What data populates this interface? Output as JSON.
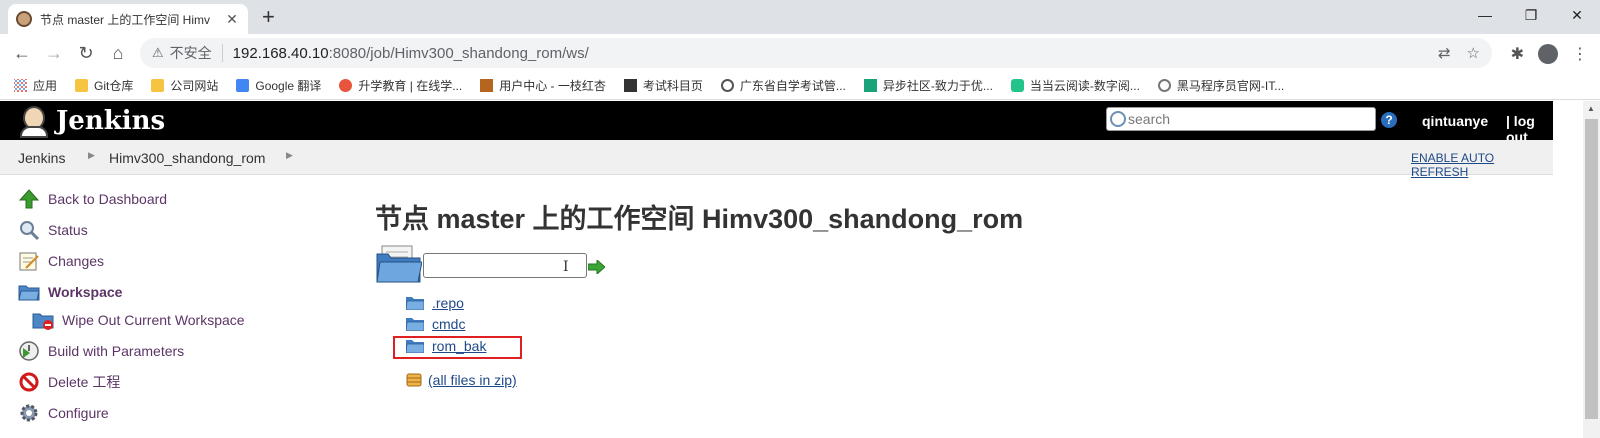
{
  "browser": {
    "tab_title": "节点 master 上的工作空间 Himv",
    "tab_close": "✕",
    "new_tab": "+",
    "window_controls": {
      "minimize": "—",
      "maximize": "❐",
      "close": "✕"
    },
    "nav": {
      "back": "←",
      "forward": "→",
      "reload": "↻",
      "home": "⌂"
    },
    "security_icon": "⚠",
    "security_label": "不安全",
    "url_host": "192.168.40.10",
    "url_path": ":8080/job/Himv300_shandong_rom/ws/",
    "omnibox_icons": {
      "translate": "⇄",
      "bookmark_star": "☆"
    },
    "toolbar_icons": {
      "extensions": "✱",
      "menu": "⋮"
    },
    "bookmarks": [
      {
        "label": "应用",
        "icon": "apps-grid-icon"
      },
      {
        "label": "Git仓库",
        "icon": "folder-icon"
      },
      {
        "label": "公司网站",
        "icon": "folder-icon"
      },
      {
        "label": "Google 翻译",
        "icon": "google-translate-icon"
      },
      {
        "label": "升学教育 | 在线学...",
        "icon": "site-icon"
      },
      {
        "label": "用户中心 - 一枝红杏",
        "icon": "site-icon"
      },
      {
        "label": "考试科目页",
        "icon": "site-icon"
      },
      {
        "label": "广东省自学考试管...",
        "icon": "globe-icon"
      },
      {
        "label": "异步社区-致力于优...",
        "icon": "site-icon"
      },
      {
        "label": "当当云阅读-数字阅...",
        "icon": "site-icon"
      },
      {
        "label": "黑马程序员官网-IT...",
        "icon": "site-icon"
      }
    ]
  },
  "jenkins": {
    "logo_text": "Jenkins",
    "search_placeholder": "search",
    "help_icon": "?",
    "user": "qintuanye",
    "logout": "| log out",
    "breadcrumbs": [
      "Jenkins",
      "Himv300_shandong_rom"
    ],
    "breadcrumb_arrow": "▶",
    "auto_refresh": "ENABLE AUTO REFRESH",
    "tasks": [
      {
        "label": "Back to Dashboard",
        "icon": "up-arrow-icon"
      },
      {
        "label": "Status",
        "icon": "magnifier-icon"
      },
      {
        "label": "Changes",
        "icon": "notepad-icon"
      },
      {
        "label": "Workspace",
        "icon": "folder-icon"
      },
      {
        "label": "Wipe Out Current Workspace",
        "icon": "folder-delete-icon"
      },
      {
        "label": "Build with Parameters",
        "icon": "clock-play-icon"
      },
      {
        "label": "Delete 工程",
        "icon": "no-entry-icon"
      },
      {
        "label": "Configure",
        "icon": "gear-icon"
      }
    ],
    "heading": "节点 master 上的工作空间 Himv300_shandong_rom",
    "path_input_value": "",
    "text_cursor": "I",
    "entries": [
      ".repo",
      "cmdc",
      "rom_bak"
    ],
    "zip_link": "(all files in zip)",
    "colors": {
      "header_bg": "#000000",
      "link": "#204a87",
      "task_link": "#5c3566",
      "highlight_box": "#e02020"
    }
  }
}
